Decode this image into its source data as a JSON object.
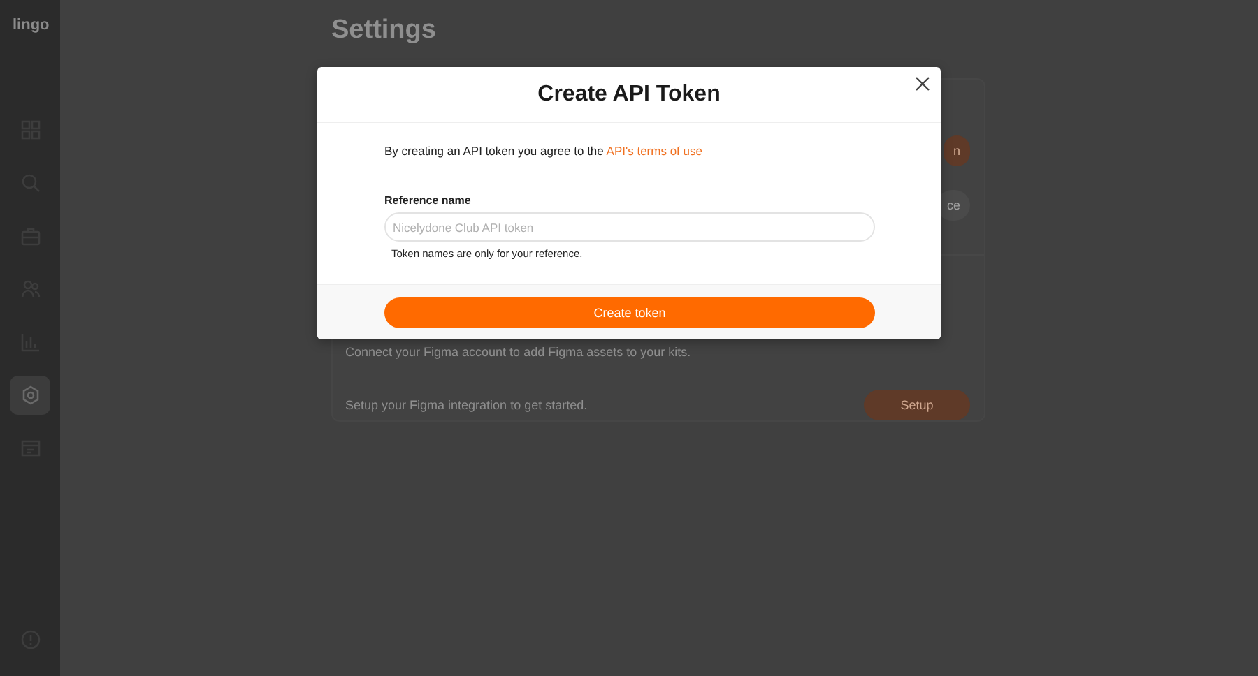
{
  "sidebar": {
    "logo": "lingo",
    "items": [
      {
        "kind": "grid",
        "selected": false
      },
      {
        "kind": "search",
        "selected": false
      },
      {
        "kind": "briefcase",
        "selected": false
      },
      {
        "kind": "users",
        "selected": false
      },
      {
        "kind": "chart",
        "selected": false
      },
      {
        "kind": "settings",
        "selected": true
      },
      {
        "kind": "layout",
        "selected": false
      }
    ]
  },
  "page": {
    "title": "Settings",
    "card": {
      "buttons": [
        {
          "label": "n",
          "kind": "primary"
        },
        {
          "label": "ce",
          "kind": "secondary"
        }
      ],
      "figma_description": "Connect your Figma account to add Figma assets to your kits.",
      "figma_setup_text": "Setup your Figma integration to get started.",
      "setup_button": "Setup"
    }
  },
  "modal": {
    "title": "Create API Token",
    "intro": "By creating an API token you agree to the",
    "intro_link": "API's terms of use",
    "field_label": "Reference name",
    "placeholder": "Nicelydone Club API token",
    "helper": "Token names are only for your reference.",
    "submit": "Create token"
  }
}
